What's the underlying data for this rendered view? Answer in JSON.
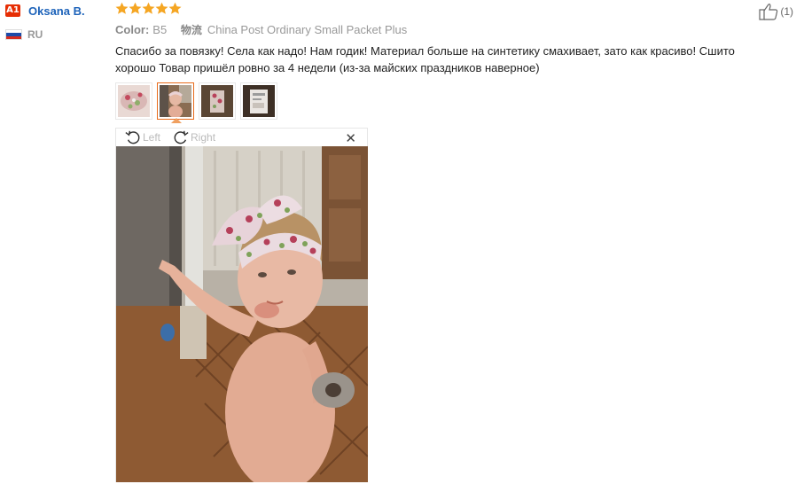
{
  "reviewer": {
    "level_badge": "A1",
    "name": "Oksana B.",
    "country": "RU"
  },
  "rating": {
    "stars": 5,
    "max": 5,
    "star_color": "#f5a623"
  },
  "product": {
    "color_label": "Color:",
    "color_value": "B5",
    "shipping_label": "物流",
    "shipping_value": "China Post Ordinary Small Packet Plus"
  },
  "review": {
    "text": "Спасибо за повязку! Села как надо! Нам годик! Материал больше на синтетику смахивает, зато как красиво! Сшито хорошо Товар пришёл ровно за 4 недели (из-за майских праздников наверное)"
  },
  "helpful": {
    "count_text": "(1)"
  },
  "viewer": {
    "rotate_left_label": "Left",
    "rotate_right_label": "Right",
    "close_glyph": "✕"
  },
  "colors": {
    "accent": "#e86b1b",
    "name_link": "#1c62b9",
    "badge": "#e62e04"
  }
}
